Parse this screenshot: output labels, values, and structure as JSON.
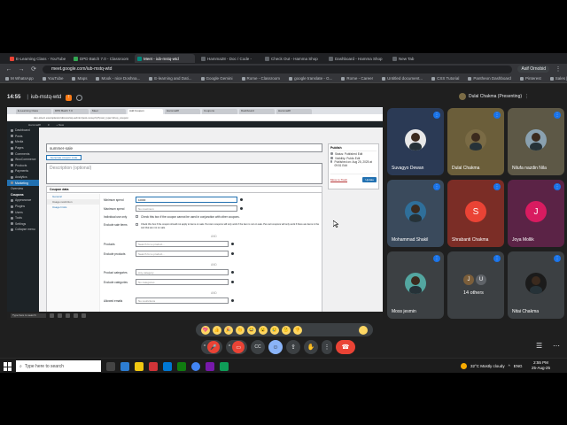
{
  "browser": {
    "tabs": [
      {
        "label": "E-Learning Class - YouTube",
        "color": "#ea4335"
      },
      {
        "label": "DPD Batch 7.0 - Classroom",
        "color": "#34a853"
      },
      {
        "label": "Meet - iub-mstq-wtd",
        "color": "#00897b"
      },
      {
        "label": "Hamma28 - Doc / Code - ",
        "color": "#5f6368"
      },
      {
        "label": "Check Out - Hamma Shop",
        "color": "#5f6368"
      },
      {
        "label": "Dashboard - Hamma Shop",
        "color": "#5f6368"
      },
      {
        "label": "New Tab",
        "color": "#5f6368"
      }
    ],
    "url": "meet.google.com/iub-mstq-wtd",
    "profile": "Asif Ornobid",
    "bookmarks": [
      "M WhatsApp",
      "YouTube",
      "Maps",
      "Mook - nice Doshna...",
      "E-learning and Dati...",
      "Google Gemini",
      "Rome - Classroom",
      "google translate - G...",
      "Rome - Career",
      "Untitled document...",
      "CSS Tutorial",
      "Pantheon Dashboard",
      "Pinterest",
      "Sales | Al Music"
    ]
  },
  "meet": {
    "time": "14:55",
    "code": "iub-mstq-wtd",
    "presenting_label": "Dulal Chakma (Presenting)"
  },
  "share": {
    "tabs": [
      "E-Learning Class",
      "DPD Batch 7.0",
      "Meet",
      "Add Coupon",
      "Hamma28",
      "Coupons",
      "Dashboard",
      "Hamma28"
    ],
    "url": "dev-site-b.example/wordpress/wp-admin/post-new.php?post_type=shop_coupon",
    "wp_bar": [
      "Hamma28",
      "0",
      "+ New"
    ],
    "menu": [
      {
        "label": "Dashboard",
        "style": ""
      },
      {
        "label": "Posts",
        "style": ""
      },
      {
        "label": "Media",
        "style": ""
      },
      {
        "label": "Pages",
        "style": ""
      },
      {
        "label": "Comments",
        "style": ""
      },
      {
        "label": "WooCommerce",
        "style": ""
      },
      {
        "label": "Products",
        "style": ""
      },
      {
        "label": "Payments",
        "style": ""
      },
      {
        "label": "Analytics",
        "style": ""
      },
      {
        "label": "Marketing",
        "style": "active"
      },
      {
        "label": "Overview",
        "style": "plain"
      },
      {
        "label": "Coupons",
        "style": "sub"
      },
      {
        "label": "Appearance",
        "style": ""
      },
      {
        "label": "Plugins",
        "style": ""
      },
      {
        "label": "Users",
        "style": ""
      },
      {
        "label": "Tools",
        "style": ""
      },
      {
        "label": "Settings",
        "style": ""
      },
      {
        "label": "Collapse menu",
        "style": ""
      }
    ],
    "coupon_code": "summer-sale",
    "generate_button": "Generate coupon code",
    "description_placeholder": "Description (optional)",
    "coupon_data_title": "Coupon data",
    "data_tabs": [
      "General",
      "Usage restriction",
      "Usage limits"
    ],
    "fields": {
      "minimum_spend_label": "Minimum spend",
      "minimum_spend_value": "10000",
      "maximum_spend_label": "Maximum spend",
      "maximum_spend_placeholder": "No maximum",
      "individual_label": "Individual use only",
      "individual_text": "Check this box if the coupon cannot be used in conjunction with other coupons.",
      "exclude_sale_label": "Exclude sale items",
      "exclude_sale_text": "Check this box if the coupon should not apply to items on sale. Per-item coupons will only work if the item is not on sale. Per-cart coupons will only work if there are items in the cart that are not on sale.",
      "and_1": "AND",
      "products_label": "Products",
      "products_placeholder": "Search for a product...",
      "exclude_products_label": "Exclude products",
      "exclude_products_placeholder": "Search for a product...",
      "and_2": "AND",
      "categories_label": "Product categories",
      "categories_placeholder": "Any category",
      "exclude_categories_label": "Exclude categories",
      "exclude_categories_placeholder": "No categories",
      "and_3": "AND",
      "allowed_emails_label": "Allowed emails",
      "allowed_emails_placeholder": "No restrictions"
    },
    "publish": {
      "title": "Publish",
      "status": "Status: Published Edit",
      "visibility": "Visibility: Public Edit",
      "published_on": "Published on: Aug 25, 2025 at 09:51 Edit",
      "trash": "Move to Trash",
      "update_button": "Update"
    },
    "taskbar_label": "Type here to search"
  },
  "participants": [
    {
      "name": "Suvagyo Dewan",
      "type": "photo",
      "color": "#2b3a55",
      "bg": "#e8e8e8"
    },
    {
      "name": "Dulal Chakma",
      "type": "photo",
      "color": "#6b5e3a",
      "bg": "#7a6b45"
    },
    {
      "name": "Nilufa nazdin Nila",
      "type": "photo",
      "color": "#5d5846",
      "bg": "#8aa1b0"
    },
    {
      "name": "Mohammad Shakil",
      "type": "photo",
      "color": "#3a4a5c",
      "bg": "#2f6f9a"
    },
    {
      "name": "Shrabanti Chakma",
      "type": "letter",
      "letter": "S",
      "color": "#7b2d26",
      "avatar": "#ea4335"
    },
    {
      "name": "Joya Mollik",
      "type": "letter",
      "letter": "J",
      "color": "#5b2346",
      "avatar": "#d81b60"
    },
    {
      "name": "Moss jesmin",
      "type": "photo",
      "color": "#3c4043",
      "bg": "#53a6a0"
    },
    {
      "name": "14 others",
      "type": "others",
      "color": "#3c4043"
    },
    {
      "name": "Nitai Chakma",
      "type": "photo",
      "color": "#3c4043",
      "bg": "#1b1b1b"
    }
  ],
  "reactions": [
    "💖",
    "👍",
    "🎉",
    "👏",
    "😂",
    "😮",
    "😢",
    "🤔",
    "👎"
  ],
  "windows": {
    "search_placeholder": "Type here to search",
    "weather": "32°C  Mostly cloudy",
    "lang": "ENG",
    "time": "2:55 PM",
    "date": "25-Aug-25"
  }
}
